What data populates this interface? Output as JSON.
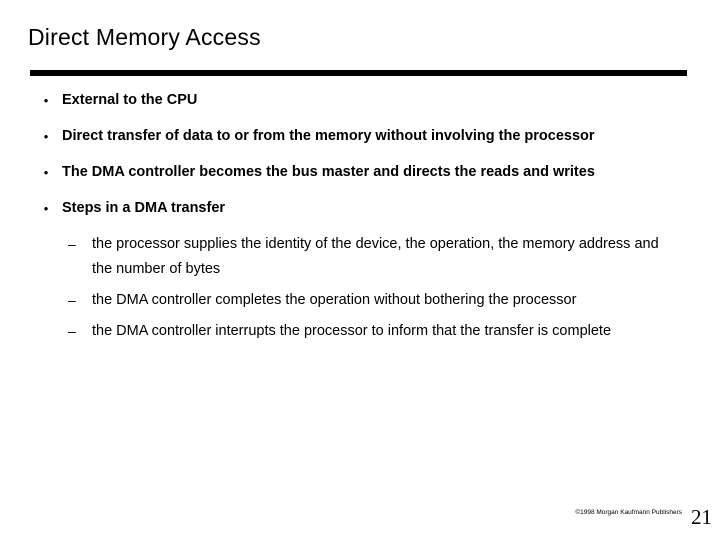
{
  "slide": {
    "title": "Direct Memory Access",
    "bullets": [
      {
        "level": 1,
        "marker": "•",
        "text": "External to the CPU"
      },
      {
        "level": 1,
        "marker": "•",
        "text": "Direct transfer of data to or from the memory without involving the processor"
      },
      {
        "level": 1,
        "marker": "•",
        "text": "The DMA controller becomes the bus master and directs the reads and writes"
      },
      {
        "level": 1,
        "marker": "•",
        "text": "Steps in a DMA transfer"
      },
      {
        "level": 2,
        "marker": "–",
        "text": "the processor supplies the identity of the device, the operation, the memory address and the number of bytes"
      },
      {
        "level": 2,
        "marker": "–",
        "text": "the DMA controller completes the operation without bothering the processor"
      },
      {
        "level": 2,
        "marker": "–",
        "text": "the DMA controller interrupts the processor to inform that the transfer is complete"
      }
    ],
    "footer": {
      "copyright": "©1998 Morgan Kaufmann Publishers",
      "page_number": "21"
    }
  }
}
